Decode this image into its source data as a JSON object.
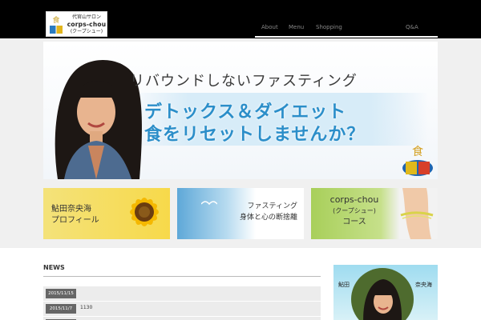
{
  "header": {
    "logo": {
      "line1": "代官山サロン",
      "line2": "corps-chou",
      "line3": "(クープシュー)"
    },
    "nav": [
      {
        "label": "About"
      },
      {
        "label": "Menu"
      },
      {
        "label": "Shopping"
      },
      {
        "label": "Q&A"
      }
    ]
  },
  "hero": {
    "tagline": "リバウンドしないファスティング",
    "headline1": "デトックス＆ダイエット",
    "headline2": "食をリセットしませんか？"
  },
  "banners": [
    {
      "line1": "鮎田奈央海",
      "line2": "プロフィール"
    },
    {
      "line1": "ファスティング",
      "line2": "身体と心の断捨離"
    },
    {
      "line1": "corps-chou",
      "line2": "(クープシュー)",
      "line3": "コース"
    }
  ],
  "news": {
    "title": "NEWS",
    "items": [
      {
        "date": "2015/11/15",
        "text": ""
      },
      {
        "date": "2015/11/7",
        "text": "1130"
      },
      {
        "date": "",
        "text": ""
      }
    ]
  },
  "profile": {
    "surname": "鮎田",
    "given": "奈央海"
  },
  "colors": {
    "header_bg": "#000000",
    "accent_blue": "#2b8ec9",
    "banner_yellow": "#f4e27a",
    "banner_green": "#a8cf5a"
  }
}
